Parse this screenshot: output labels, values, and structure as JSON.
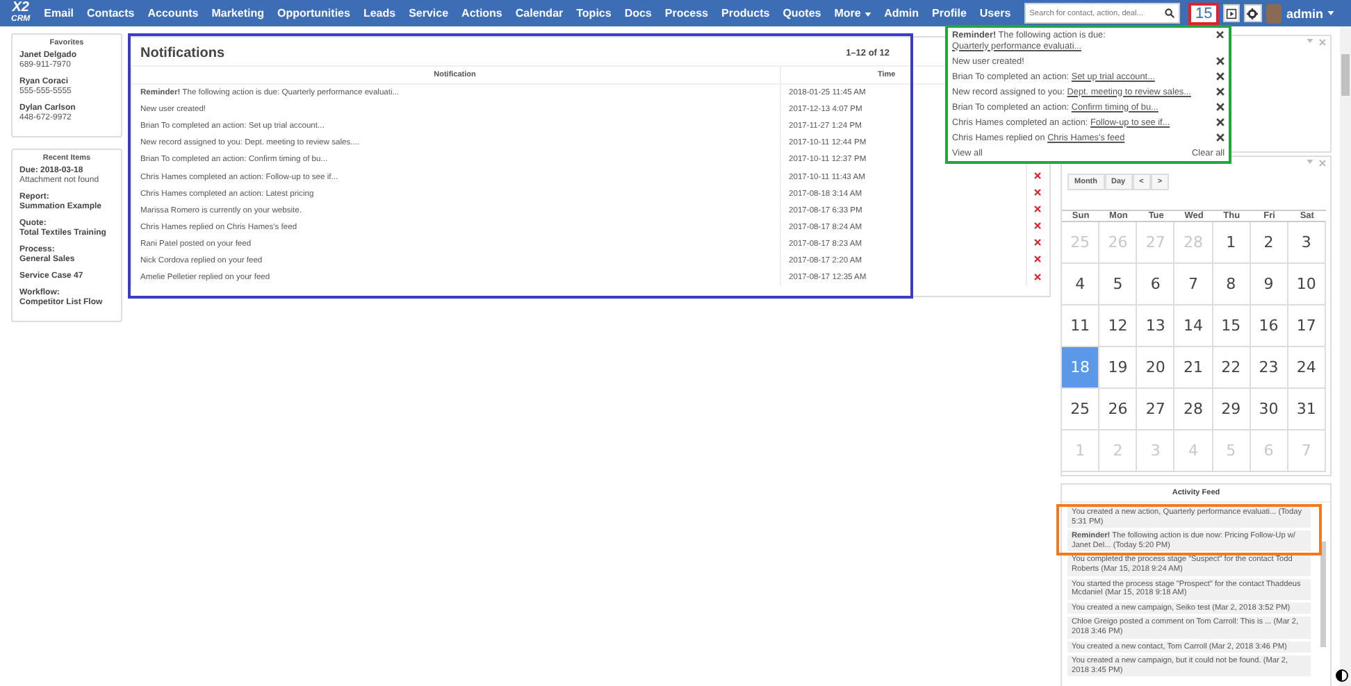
{
  "nav": {
    "logo_top": "X2",
    "logo_bottom": "CRM",
    "items": [
      "Email",
      "Contacts",
      "Accounts",
      "Marketing",
      "Opportunities",
      "Leads",
      "Service",
      "Actions",
      "Calendar",
      "Topics",
      "Docs",
      "Process",
      "Products",
      "Quotes"
    ],
    "more": "More",
    "right_links": [
      "Admin",
      "Profile",
      "Users"
    ],
    "search": {
      "placeholder": "Search for contact, action, deal..."
    },
    "notification_count": "15",
    "user": "admin"
  },
  "favorites": {
    "title": "Favorites",
    "items": [
      {
        "name": "Janet Delgado",
        "phone": "689-911-7970"
      },
      {
        "name": "Ryan Coraci",
        "phone": "555-555-5555"
      },
      {
        "name": "Dylan Carlson",
        "phone": "448-672-9972"
      }
    ]
  },
  "recent_items": {
    "title": "Recent Items",
    "items": [
      {
        "title": "Due: 2018-03-18",
        "detail": "Attachment not found"
      },
      {
        "title": "Report:",
        "value": "Summation Example"
      },
      {
        "title": "Quote:",
        "value": "Total Textiles Training"
      },
      {
        "title": "Process:",
        "value": "General Sales"
      },
      {
        "title": "Service Case 47"
      },
      {
        "title": "Workflow:",
        "value": "Competitor List Flow"
      }
    ]
  },
  "notifications": {
    "title": "Notifications",
    "pager": "1–12 of 12",
    "columns": [
      "Notification",
      "Time"
    ],
    "rows": [
      {
        "text": "**Reminder!** The following action is due: Quarterly performance evaluati...",
        "time": "2018-01-25 11:45 AM"
      },
      {
        "text": "New user created!",
        "time": "2017-12-13 4:07 PM"
      },
      {
        "text": "Brian To completed an action: Set up trial account...",
        "time": "2017-11-27 1:24 PM"
      },
      {
        "text": "New record assigned to you: Dept. meeting to review sales....",
        "time": "2017-10-11 12:44 PM"
      },
      {
        "text": "Brian To completed an action: Confirm timing of bu...",
        "time": "2017-10-11 12:37 PM"
      },
      {
        "text": "Chris Hames completed an action: Follow-up to see if...",
        "time": "2017-10-11 11:43 AM"
      },
      {
        "text": "Chris Hames completed an action: Latest pricing",
        "time": "2017-08-18 3:14 AM"
      },
      {
        "text": "Marissa Romero is currently on your website.",
        "time": "2017-08-17 6:33 PM"
      },
      {
        "text": "Chris Hames replied on Chris Hames's feed",
        "time": "2017-08-17 8:24 AM"
      },
      {
        "text": "Rani Patel posted on your feed",
        "time": "2017-08-17 8:23 AM"
      },
      {
        "text": "Nick Cordova replied on your feed",
        "time": "2017-08-17 2:20 AM"
      },
      {
        "text": "Amelie Pelletier replied on your feed",
        "time": "2017-08-17 12:35 AM"
      }
    ]
  },
  "dropdown": {
    "items": [
      {
        "text": "**Reminder!** The following action is due: ",
        "link": "Quarterly performance evaluati..."
      },
      {
        "text": "New user created!"
      },
      {
        "text": "Brian To completed an action: ",
        "link": "Set up trial account..."
      },
      {
        "text": "New record assigned to you: ",
        "link": "Dept. meeting to review sales..."
      },
      {
        "text": "Brian To completed an action: ",
        "link": "Confirm timing of bu..."
      },
      {
        "text": "Chris Hames completed an action: ",
        "link": "Follow-up to see if..."
      },
      {
        "text": "Chris Hames replied on ",
        "link": "Chris Hames's feed"
      }
    ],
    "view_all": "View all",
    "clear_all": "Clear all"
  },
  "calendar": {
    "buttons": [
      "Month",
      "Day",
      "<",
      ">"
    ],
    "weekdays": [
      "Sun",
      "Mon",
      "Tue",
      "Wed",
      "Thu",
      "Fri",
      "Sat"
    ],
    "weeks": [
      [
        {
          "day": "25",
          "other_month": true,
          "selected": false
        },
        {
          "day": "26",
          "other_month": true,
          "selected": false
        },
        {
          "day": "27",
          "other_month": true,
          "selected": false
        },
        {
          "day": "28",
          "other_month": true,
          "selected": false
        },
        {
          "day": "1",
          "other_month": false,
          "selected": false
        },
        {
          "day": "2",
          "other_month": false,
          "selected": false
        },
        {
          "day": "3",
          "other_month": false,
          "selected": false
        }
      ],
      [
        {
          "day": "4",
          "other_month": false,
          "selected": false
        },
        {
          "day": "5",
          "other_month": false,
          "selected": false
        },
        {
          "day": "6",
          "other_month": false,
          "selected": false
        },
        {
          "day": "7",
          "other_month": false,
          "selected": false
        },
        {
          "day": "8",
          "other_month": false,
          "selected": false
        },
        {
          "day": "9",
          "other_month": false,
          "selected": false
        },
        {
          "day": "10",
          "other_month": false,
          "selected": false
        }
      ],
      [
        {
          "day": "11",
          "other_month": false,
          "selected": false
        },
        {
          "day": "12",
          "other_month": false,
          "selected": false
        },
        {
          "day": "13",
          "other_month": false,
          "selected": false
        },
        {
          "day": "14",
          "other_month": false,
          "selected": false
        },
        {
          "day": "15",
          "other_month": false,
          "selected": false
        },
        {
          "day": "16",
          "other_month": false,
          "selected": false
        },
        {
          "day": "17",
          "other_month": false,
          "selected": false
        }
      ],
      [
        {
          "day": "18",
          "other_month": false,
          "selected": true
        },
        {
          "day": "19",
          "other_month": false,
          "selected": false
        },
        {
          "day": "20",
          "other_month": false,
          "selected": false
        },
        {
          "day": "21",
          "other_month": false,
          "selected": false
        },
        {
          "day": "22",
          "other_month": false,
          "selected": false
        },
        {
          "day": "23",
          "other_month": false,
          "selected": false
        },
        {
          "day": "24",
          "other_month": false,
          "selected": false
        }
      ],
      [
        {
          "day": "25",
          "other_month": false,
          "selected": false
        },
        {
          "day": "26",
          "other_month": false,
          "selected": false
        },
        {
          "day": "27",
          "other_month": false,
          "selected": false
        },
        {
          "day": "28",
          "other_month": false,
          "selected": false
        },
        {
          "day": "29",
          "other_month": false,
          "selected": false
        },
        {
          "day": "30",
          "other_month": false,
          "selected": false
        },
        {
          "day": "31",
          "other_month": false,
          "selected": false
        }
      ],
      [
        {
          "day": "1",
          "other_month": true,
          "selected": false
        },
        {
          "day": "2",
          "other_month": true,
          "selected": false
        },
        {
          "day": "3",
          "other_month": true,
          "selected": false
        },
        {
          "day": "4",
          "other_month": true,
          "selected": false
        },
        {
          "day": "5",
          "other_month": true,
          "selected": false
        },
        {
          "day": "6",
          "other_month": true,
          "selected": false
        },
        {
          "day": "7",
          "other_month": true,
          "selected": false
        }
      ]
    ]
  },
  "activity_feed": {
    "title": "Activity Feed",
    "items": [
      {
        "text": "You created a new action, Quarterly performance evaluati... (Today 5:31 PM)"
      },
      {
        "text": "**Reminder!** The following action is due now: Pricing Follow-Up w/ Janet Del... (Today 5:20 PM)"
      },
      {
        "text": "You completed the process stage \"Suspect\" for the contact Todd Roberts (Mar 15, 2018 9:24 AM)"
      },
      {
        "text": "You started the process stage \"Prospect\" for the contact Thaddeus Mcdaniel (Mar 15, 2018 9:18 AM)"
      },
      {
        "text": "You created a new campaign, Seiko test (Mar 2, 2018 3:52 PM)"
      },
      {
        "text": "Chloe Greigo posted a comment on Tom Carroll: This is ... (Mar 2, 2018 3:46 PM)"
      },
      {
        "text": "You created a new contact, Tom Carroll (Mar 2, 2018 3:46 PM)"
      },
      {
        "text": "You created a new campaign, but it could not be found. (Mar 2, 2018 3:45 PM)"
      }
    ]
  }
}
